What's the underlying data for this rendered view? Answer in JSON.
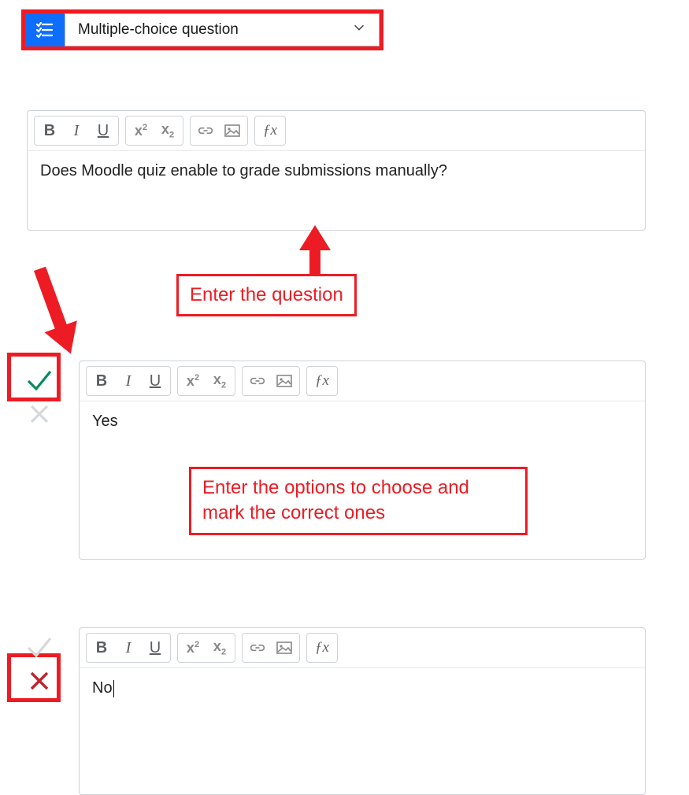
{
  "qtype": {
    "label": "Multiple-choice question"
  },
  "toolbar": {
    "bold": "B",
    "italic": "I",
    "underline": "U",
    "sup": "x",
    "sub": "x",
    "fx": "ƒx"
  },
  "question": {
    "text": "Does Moodle quiz enable to grade submissions manually?"
  },
  "options": [
    {
      "text": "Yes",
      "correct": true
    },
    {
      "text": "No",
      "correct": false
    }
  ],
  "annotations": {
    "enter_question": "Enter the question",
    "enter_options": "Enter the options to choose and mark the correct ones"
  }
}
